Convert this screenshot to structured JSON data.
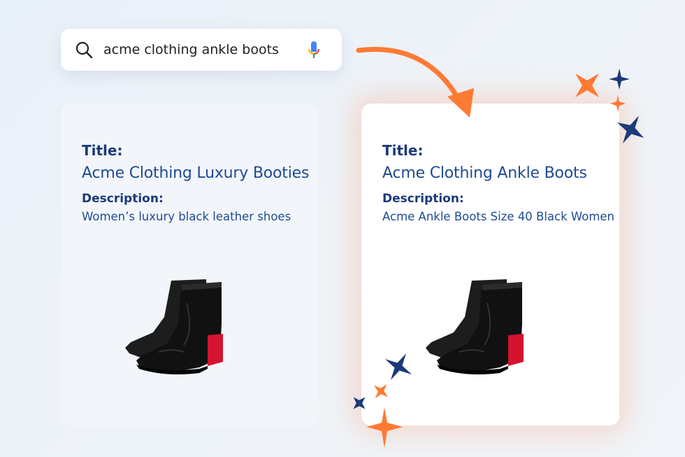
{
  "search": {
    "query": "acme clothing ankle boots",
    "icon": "search-icon",
    "mic_icon": "microphone-icon"
  },
  "cards": [
    {
      "title_label": "Title:",
      "title": "Acme Clothing Luxury Booties",
      "description_label": "Description:",
      "description": "Women’s luxury black leather shoes",
      "image": "ankle-boot-image"
    },
    {
      "title_label": "Title:",
      "title": "Acme Clothing Ankle Boots",
      "description_label": "Description:",
      "description": "Acme Ankle Boots Size 40 Black Women",
      "image": "ankle-boot-image"
    }
  ],
  "colors": {
    "accent_orange": "#ff7a33",
    "accent_navy": "#1c3a7a",
    "text_blue": "#1f4b91",
    "card_left_bg": "#f2f6fa",
    "card_right_bg": "#ffffff"
  }
}
